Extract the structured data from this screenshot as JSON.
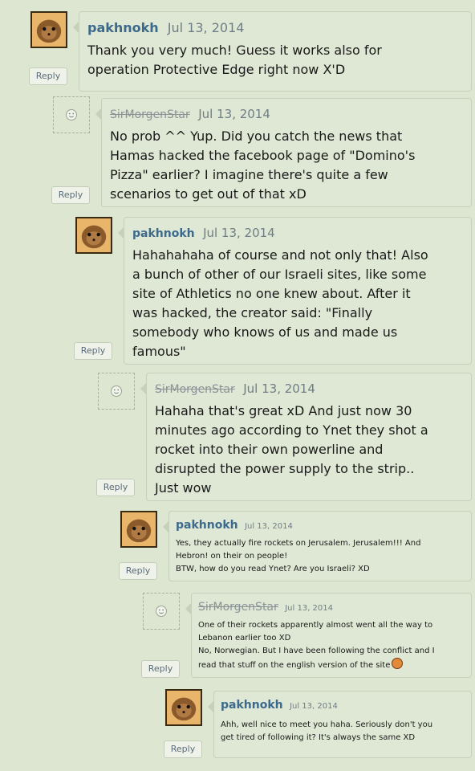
{
  "reply_label": "Reply",
  "colors": {
    "background": "#dce6d0",
    "username": "#3d6a8c",
    "date": "#6f7d86"
  },
  "comments": [
    {
      "user": "pakhnokh",
      "date": "Jul 13, 2014",
      "avatar": "hamster-avatar",
      "text": "Thank you very much! Guess it works also for\noperation Protective Edge right now X'D"
    },
    {
      "user": "SirMorgenStar",
      "date": "Jul 13, 2014",
      "avatar": "default-smiley-avatar",
      "text": "No prob ^^ Yup. Did you catch the news that\nHamas hacked the facebook page of \"Domino's\nPizza\" earlier? I imagine there's quite a few\nscenarios to get out of that xD"
    },
    {
      "user": "pakhnokh",
      "date": "Jul 13, 2014",
      "avatar": "hamster-avatar",
      "text": "Hahahahaha of course and not only that! Also\na bunch of other of our Israeli sites, like some\nsite of Athletics no one knew about. After it\nwas hacked, the creator said: \"Finally\nsomebody who knows of us and made us\nfamous\""
    },
    {
      "user": "SirMorgenStar",
      "date": "Jul 13, 2014",
      "avatar": "default-smiley-avatar",
      "text": "Hahaha that's great xD And just now 30\nminutes ago according to Ynet they shot a\nrocket into their own powerline and\ndisrupted the power supply to the strip..\nJust wow"
    },
    {
      "user": "pakhnokh",
      "date": "Jul 13, 2014",
      "avatar": "hamster-avatar",
      "text": "Yes, they actually fire rockets on Jerusalem. Jerusalem!!! And\nHebron! on their on people!\nBTW, how do you read Ynet? Are you Israeli? XD"
    },
    {
      "user": "SirMorgenStar",
      "date": "Jul 13, 2014",
      "avatar": "default-smiley-avatar",
      "text": "One of their rockets apparently almost went all the way to\nLebanon earlier too XD\nNo, Norwegian. But I have been following the conflict and I\nread that stuff on the english version of the site"
    },
    {
      "user": "pakhnokh",
      "date": "Jul 13, 2014",
      "avatar": "hamster-avatar",
      "text": "Ahh, well nice to meet you haha. Seriously don't you\nget tired of following it? It's always the same XD"
    }
  ]
}
